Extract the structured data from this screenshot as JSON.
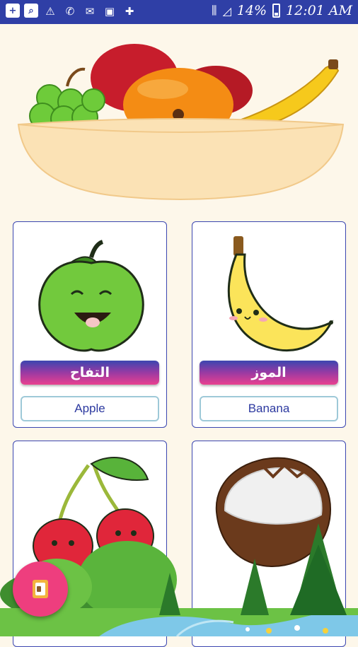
{
  "status_bar": {
    "battery_percent": "14%",
    "time": "12:01 AM",
    "icons": [
      "add-box-icon",
      "search-box-icon",
      "warning-icon",
      "phone-icon",
      "muted-notification-icon",
      "image-icon",
      "medical-plus-icon",
      "vibrate-icon",
      "signal-icon",
      "battery-icon"
    ]
  },
  "header": {
    "image": "fruit-bowl-illustration"
  },
  "cards": [
    {
      "arabic": "التفاح",
      "english": "Apple",
      "image": "apple-illustration"
    },
    {
      "arabic": "الموز",
      "english": "Banana",
      "image": "banana-illustration"
    },
    {
      "arabic": "",
      "english": "",
      "image": "cherry-illustration"
    },
    {
      "arabic": "",
      "english": "",
      "image": "coconut-illustration"
    }
  ],
  "fab": {
    "icon": "book-icon",
    "color": "#ee3e7e"
  },
  "colors": {
    "status_bar": "#2f3fa6",
    "background": "#fdf7ea",
    "card_border": "#3b46b0",
    "label_gradient_top": "#3b46b0",
    "label_gradient_bottom": "#e9408f"
  }
}
